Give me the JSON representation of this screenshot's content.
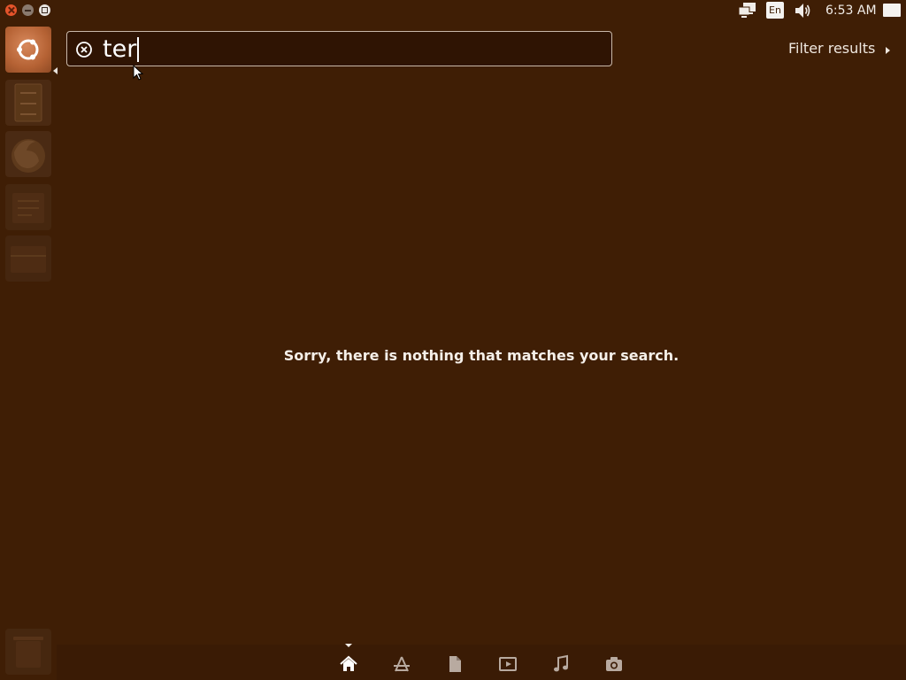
{
  "panel": {
    "clock": "6:53 AM",
    "keyboard_layout": "En",
    "icons": [
      "network-icon",
      "keyboard-icon",
      "volume-icon",
      "session-icon"
    ]
  },
  "window_controls": [
    "close",
    "minimize",
    "maximize"
  ],
  "launcher": {
    "items": [
      "dash-home",
      "files",
      "firefox",
      "libreoffice-writer",
      "libreoffice-calc",
      "trash"
    ]
  },
  "search": {
    "value": "ter",
    "placeholder": ""
  },
  "filter": {
    "label": "Filter results"
  },
  "results": {
    "empty_message": "Sorry, there is nothing that matches your search."
  },
  "lenses": [
    "home",
    "applications",
    "files",
    "video",
    "music",
    "photos"
  ],
  "colors": {
    "background": "#3f1e05",
    "accent": "#dd4814"
  }
}
